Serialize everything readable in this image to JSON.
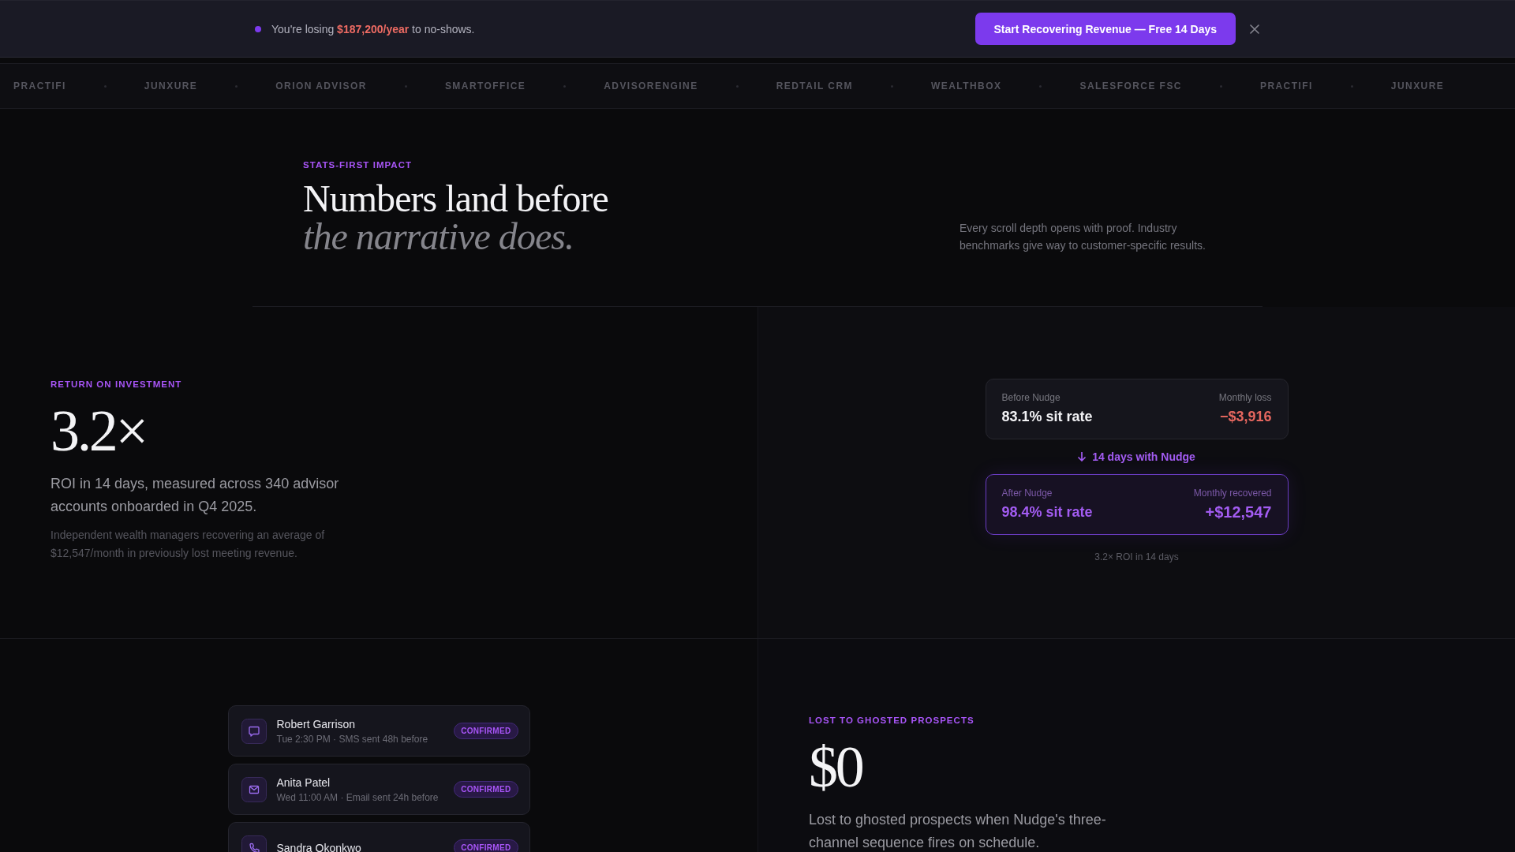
{
  "promo_banner": {
    "message": "You're losing **$187,200/year** to no-shows.",
    "cta": "Start Recovering Revenue — Free 14 Days"
  },
  "integrations": [
    "PRACTIFI",
    "JUNXURE",
    "ORION ADVISOR",
    "SMARTOFFICE",
    "ADVISORENGINE",
    "REDTAIL CRM",
    "WEALTHBOX",
    "SALESFORCE FSC",
    "PRACTIFI",
    "JUNXURE"
  ],
  "hero": {
    "eyebrow": "STATS-FIRST IMPACT",
    "title": "Numbers land before *the narrative does.*",
    "description": "Every scroll depth opens with proof. Industry benchmarks give way to customer-specific results."
  },
  "roi": {
    "eyebrow": "RETURN ON INVESTMENT",
    "figure": "3.2×",
    "summary": "ROI in 14 days, measured across 340 advisor accounts onboarded in Q4 2025.",
    "note": "Independent wealth managers recovering an average of $12,547/month in previously lost meeting revenue.",
    "before_card": {
      "label": "Before Nudge",
      "value": "83.1% sit rate",
      "side_label": "Monthly loss",
      "side_value": "−$3,916"
    },
    "transition": "14 days with Nudge",
    "after_card": {
      "label": "After Nudge",
      "value": "98.4% sit rate",
      "side_label": "Monthly recovered",
      "side_value": "+$12,547"
    },
    "caption": "3.2× ROI in 14 days"
  },
  "appointments": [
    {
      "kind": "sms",
      "name": "Robert Garrison",
      "detail": "Tue 2:30 PM · SMS sent 48h before",
      "status": "CONFIRMED"
    },
    {
      "kind": "email",
      "name": "Anita Patel",
      "detail": "Wed 11:00 AM · Email sent 24h before",
      "status": "CONFIRMED"
    },
    {
      "kind": "phone",
      "name": "Sandra Okonkwo",
      "status": "CONFIRMED"
    }
  ],
  "ghosted": {
    "eyebrow": "LOST TO GHOSTED PROSPECTS",
    "figure": "$0",
    "description": "Lost to ghosted prospects when Nudge's three-channel sequence fires on schedule."
  }
}
